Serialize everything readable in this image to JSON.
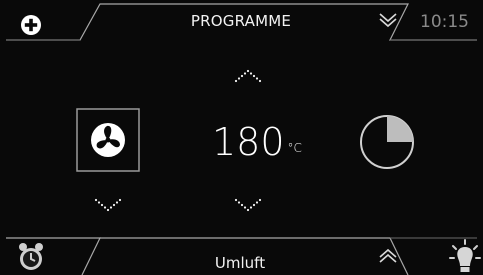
{
  "header": {
    "programme_label": "PROGRAMME",
    "time": "10:15",
    "add_icon": "plus-circle-icon",
    "programme_dropdown_icon": "double-chevron-down-icon"
  },
  "main": {
    "temperature": {
      "value": "180",
      "unit": "°C"
    },
    "fan_icon": "fan-icon",
    "timer_icon": "pie-timer-icon",
    "timer_fraction": 0.25
  },
  "footer": {
    "mode_label": "Umluft",
    "mode_up_icon": "double-chevron-up-icon",
    "alarm_icon": "alarm-clock-icon",
    "light_icon": "light-bulb-icon"
  },
  "colors": {
    "background": "#090909",
    "text": "#f2f2f2",
    "muted": "#8a8a8a",
    "frame": "#b5b5b5"
  }
}
